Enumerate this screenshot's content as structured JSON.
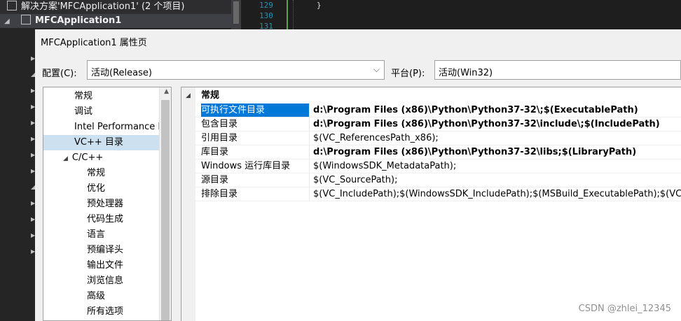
{
  "solution_explorer": {
    "solution_label": "解决方案'MFCApplication1' (2 个项目)",
    "project_label": "MFCApplication1"
  },
  "code_editor": {
    "line_numbers": [
      "129",
      "130",
      "131"
    ],
    "brace": "}"
  },
  "dialog": {
    "title": "MFCApplication1 属性页",
    "config_label": "配置(C):",
    "config_value": "活动(Release)",
    "platform_label": "平台(P):",
    "platform_value": "活动(Win32)"
  },
  "tree": {
    "items": [
      {
        "label": "常规",
        "indent": 1
      },
      {
        "label": "调试",
        "indent": 1
      },
      {
        "label": "Intel Performance Li",
        "indent": 1
      },
      {
        "label": "VC++ 目录",
        "indent": 1,
        "selected": true
      },
      {
        "label": "C/C++",
        "indent": 1,
        "expanded": true
      },
      {
        "label": "常规",
        "indent": 2
      },
      {
        "label": "优化",
        "indent": 2
      },
      {
        "label": "预处理器",
        "indent": 2
      },
      {
        "label": "代码生成",
        "indent": 2
      },
      {
        "label": "语言",
        "indent": 2
      },
      {
        "label": "预编译头",
        "indent": 2
      },
      {
        "label": "输出文件",
        "indent": 2
      },
      {
        "label": "浏览信息",
        "indent": 2
      },
      {
        "label": "高级",
        "indent": 2
      },
      {
        "label": "所有选项",
        "indent": 2
      }
    ]
  },
  "grid": {
    "category": "常规",
    "rows": [
      {
        "name": "可执行文件目录",
        "value": "d:\\Program Files (x86)\\Python\\Python37-32\\;$(ExecutablePath)",
        "bold": true,
        "selected": true
      },
      {
        "name": "包含目录",
        "value": "d:\\Program Files (x86)\\Python\\Python37-32\\include\\;$(IncludePath)",
        "bold": true
      },
      {
        "name": "引用目录",
        "value": "$(VC_ReferencesPath_x86);",
        "bold": false
      },
      {
        "name": "库目录",
        "value": "d:\\Program Files (x86)\\Python\\Python37-32\\libs;$(LibraryPath)",
        "bold": true
      },
      {
        "name": "Windows 运行库目录",
        "value": "$(WindowsSDK_MetadataPath);",
        "bold": false
      },
      {
        "name": "源目录",
        "value": "$(VC_SourcePath);",
        "bold": false
      },
      {
        "name": "排除目录",
        "value": "$(VC_IncludePath);$(WindowsSDK_IncludePath);$(MSBuild_ExecutablePath);$(VC_Libr",
        "bold": false
      }
    ]
  },
  "watermark": "CSDN @zhlei_12345"
}
